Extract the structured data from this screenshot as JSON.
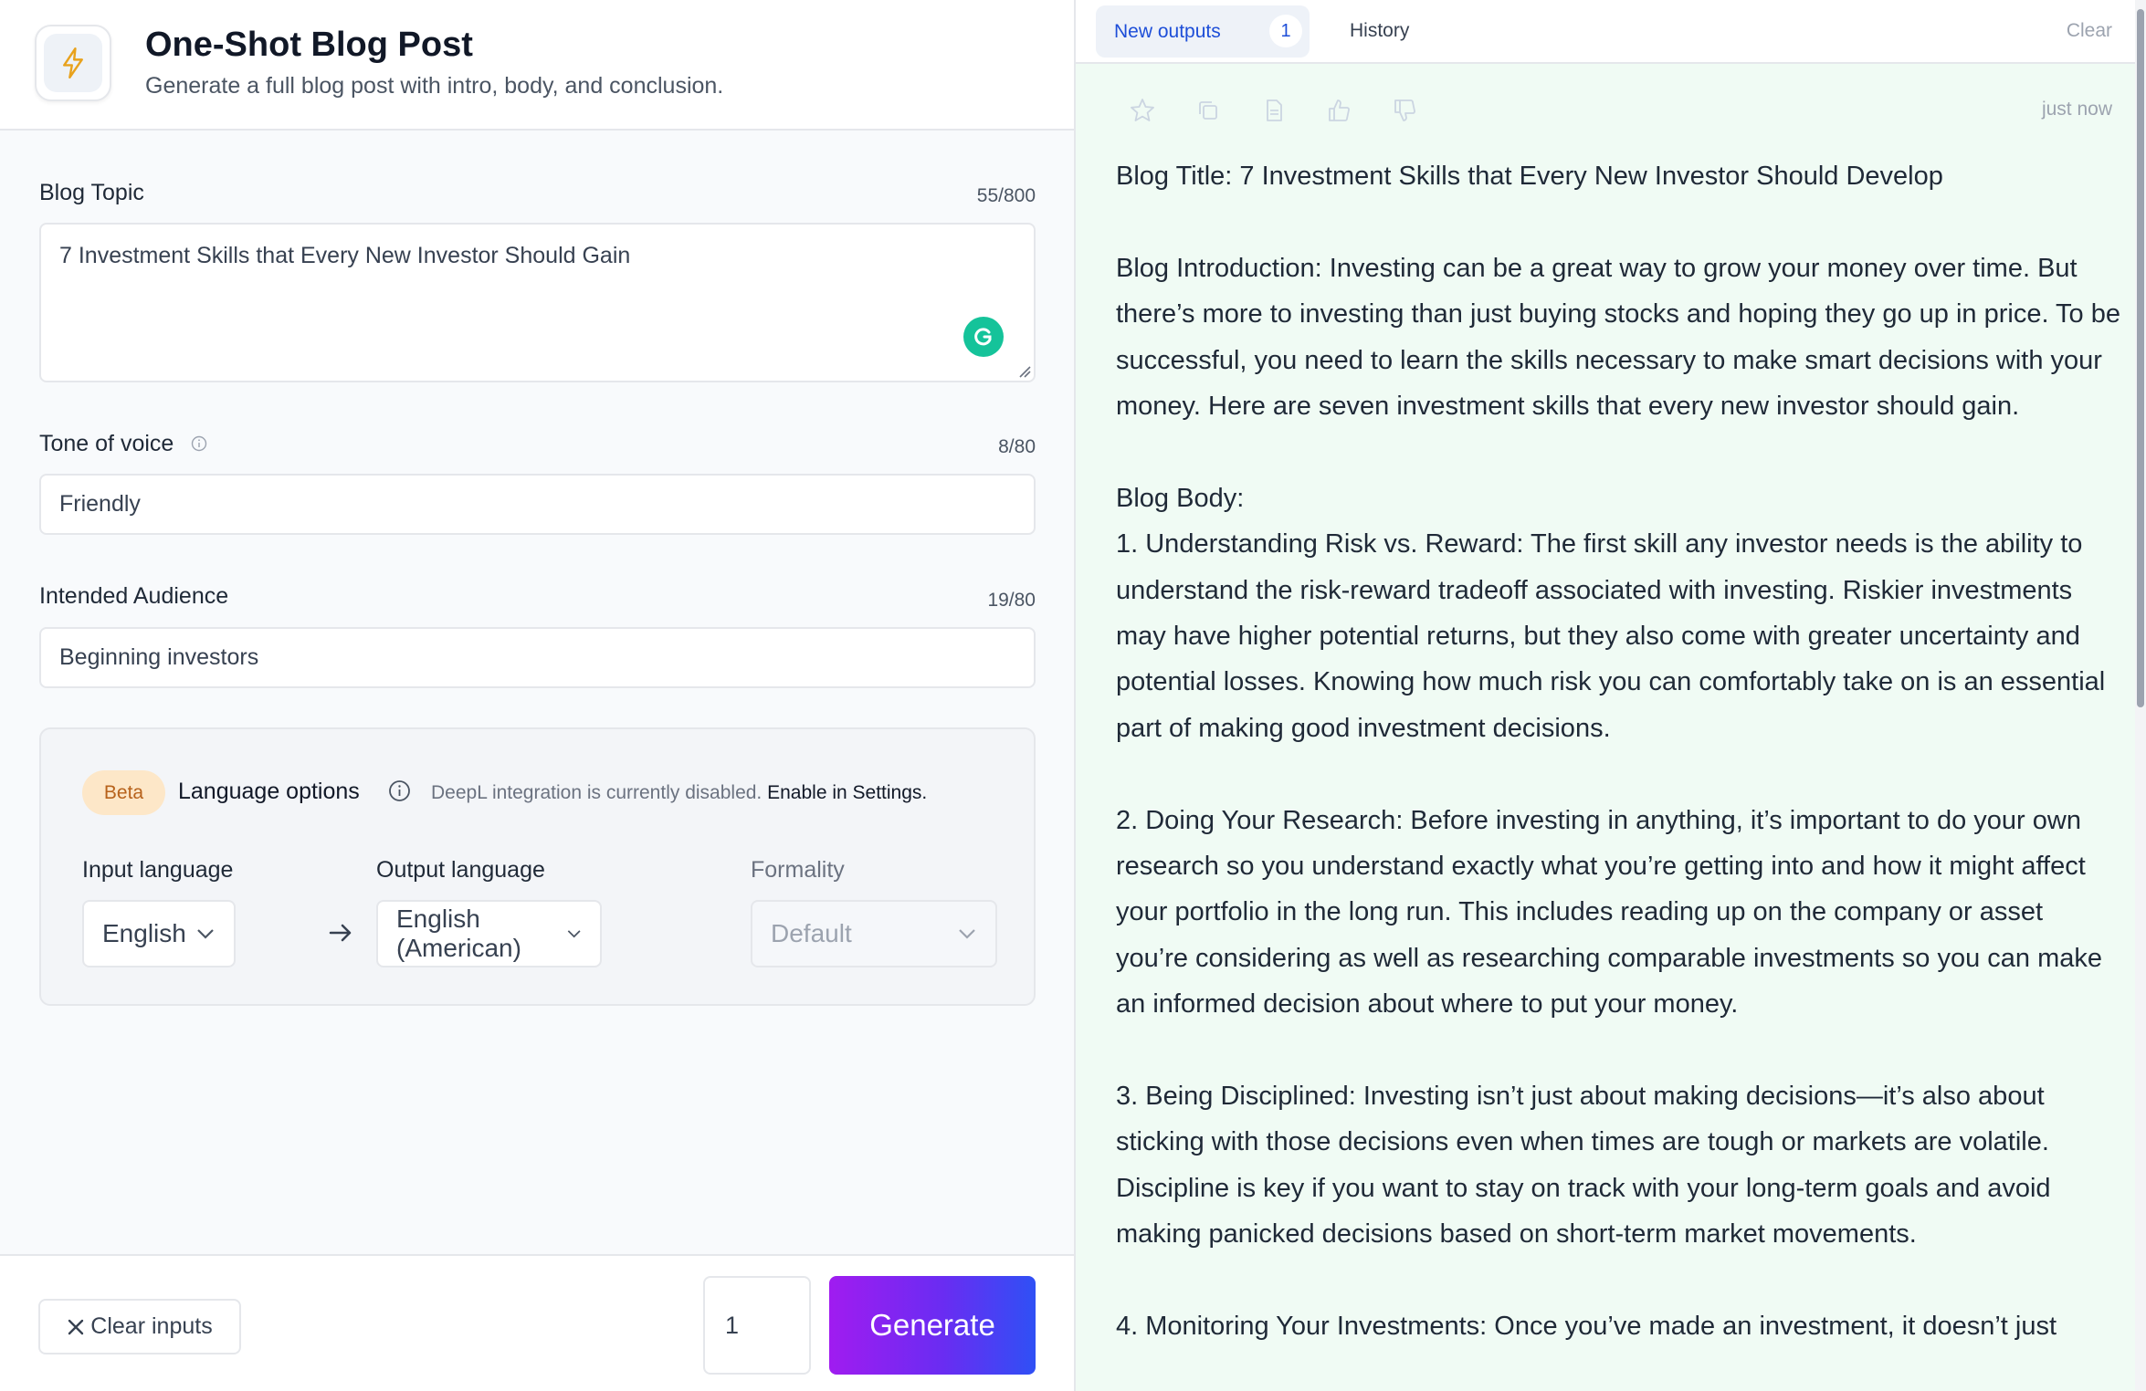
{
  "app": {
    "title": "One-Shot Blog Post",
    "subtitle": "Generate a full blog post with intro, body, and conclusion.",
    "icon": "lightning-icon"
  },
  "form": {
    "blog_topic": {
      "label": "Blog Topic",
      "counter": "55/800",
      "value": "7 Investment Skills that Every New Investor Should Gain"
    },
    "tone": {
      "label": "Tone of voice",
      "counter": "8/80",
      "value": "Friendly"
    },
    "audience": {
      "label": "Intended Audience",
      "counter": "19/80",
      "value": "Beginning investors"
    }
  },
  "language": {
    "badge": "Beta",
    "title": "Language options",
    "note": "DeepL integration is currently disabled.",
    "note_link": "Enable in Settings.",
    "input_label": "Input language",
    "input_value": "English",
    "output_label": "Output language",
    "output_value": "English (American)",
    "formality_label": "Formality",
    "formality_value": "Default"
  },
  "footer": {
    "clear_label": "Clear inputs",
    "quantity": "1",
    "generate_label": "Generate"
  },
  "outputs": {
    "tab_new": "New outputs",
    "tab_new_count": "1",
    "tab_history": "History",
    "clear": "Clear",
    "timestamp": "just now",
    "paragraphs": [
      "Blog Title: 7 Investment Skills that Every New Investor Should Develop",
      "",
      "Blog Introduction: Investing can be a great way to grow your money over time. But there’s more to investing than just buying stocks and hoping they go up in price. To be successful, you need to learn the skills necessary to make smart decisions with your money. Here are seven investment skills that every new investor should gain.",
      "",
      "Blog Body:",
      "1. Understanding Risk vs. Reward: The first skill any investor needs is the ability to understand the risk-reward tradeoff associated with investing. Riskier investments may have higher potential returns, but they also come with greater uncertainty and potential losses. Knowing how much risk you can comfortably take on is an essential part of making good investment decisions.",
      "",
      "2. Doing Your Research: Before investing in anything, it’s important to do your own research so you understand exactly what you’re getting into and how it might affect your portfolio in the long run. This includes reading up on the company or asset you’re considering as well as researching comparable investments so you can make an informed decision about where to put your money.",
      "",
      "3. Being Disciplined: Investing isn’t just about making decisions—it’s also about sticking with those decisions even when times are tough or markets are volatile. Discipline is key if you want to stay on track with your long-term goals and avoid making panicked decisions based on short-term market movements.",
      "",
      "4. Monitoring Your Investments: Once you’ve made an investment, it doesn’t just"
    ]
  },
  "colors": {
    "accent_blue": "#1d4ed8",
    "output_bg": "#f0fbf4",
    "generate_start": "#a01cf0",
    "generate_end": "#2f50f5",
    "beta_bg": "#fde7c8",
    "grammarly": "#15c39a"
  }
}
